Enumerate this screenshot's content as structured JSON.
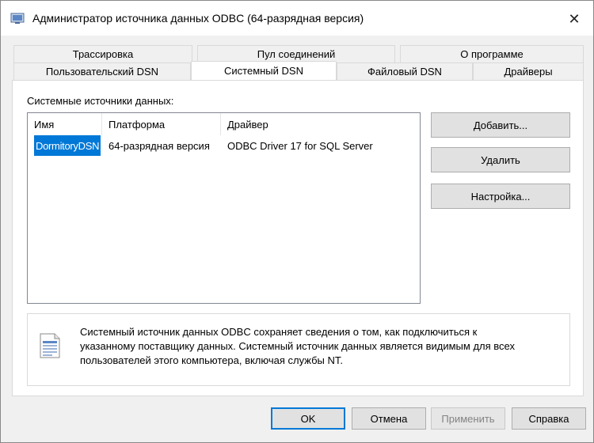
{
  "window": {
    "title": "Администратор источника данных ODBC (64-разрядная версия)",
    "close_glyph": "✕"
  },
  "tabs": {
    "row_back": [
      "Трассировка",
      "Пул соединений",
      "О программе"
    ],
    "row_front": [
      "Пользовательский DSN",
      "Системный DSN",
      "Файловый DSN",
      "Драйверы"
    ],
    "active": "Системный DSN"
  },
  "system_dsn": {
    "section_label": "Системные источники данных:",
    "columns": [
      "Имя",
      "Платформа",
      "Драйвер"
    ],
    "rows": [
      {
        "name": "DormitoryDSN",
        "platform": "64-разрядная версия",
        "driver": "ODBC Driver 17 for SQL Server",
        "selected": true
      }
    ],
    "buttons": {
      "add": "Добавить...",
      "remove": "Удалить",
      "configure": "Настройка..."
    },
    "info": {
      "icon": "document-database-icon",
      "lines": [
        "Системный источник данных ODBC сохраняет сведения о том, как подключиться к",
        "указанному поставщику данных.  Системный источник данных является видимым для всех",
        "пользователей этого компьютера, включая службы NT."
      ]
    }
  },
  "footer": {
    "ok": "OK",
    "cancel": "Отмена",
    "apply": "Применить",
    "help": "Справка"
  },
  "colors": {
    "accent": "#0078d7",
    "button_face": "#e1e1e1",
    "disabled_text": "#838383"
  }
}
